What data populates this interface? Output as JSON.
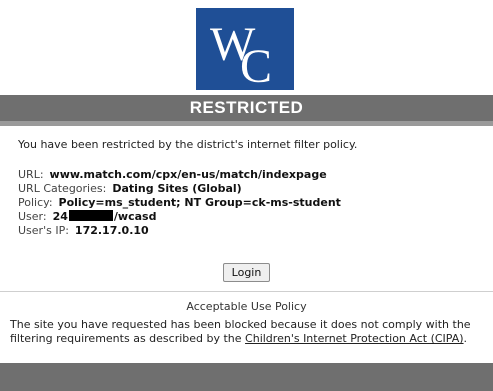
{
  "logo": {
    "text_w": "W",
    "text_c": "C",
    "bg_color": "#1f4f96"
  },
  "banner": {
    "title": "RESTRICTED"
  },
  "message": {
    "intro": "You have been restricted by the district's internet filter policy."
  },
  "details": {
    "url_label": "URL:",
    "url_value": "www.match.com/cpx/en-us/match/indexpage",
    "categories_label": "URL Categories:",
    "categories_value": "Dating Sites (Global)",
    "policy_label": "Policy:",
    "policy_value": "Policy=ms_student; NT Group=ck-ms-student",
    "user_label": "User:",
    "user_prefix": "24",
    "user_suffix": "/wcasd",
    "ip_label": "User's IP:",
    "ip_value": "172.17.0.10"
  },
  "login": {
    "label": "Login"
  },
  "aup": {
    "title": "Acceptable Use Policy",
    "text_before": "The site you have requested has been blocked because it does not comply with the filtering requirements as described by the ",
    "link_text": "Children's Internet Protection Act (CIPA)",
    "text_after": "."
  }
}
